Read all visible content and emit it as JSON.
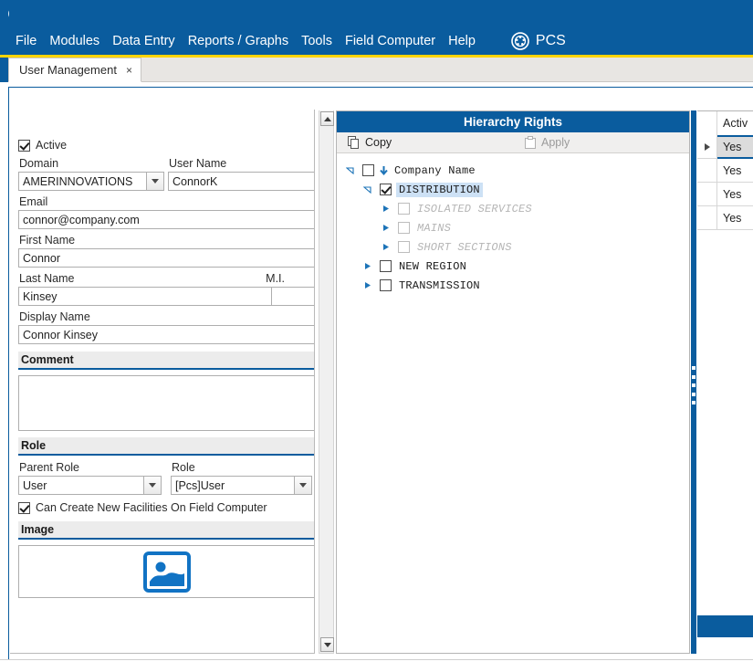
{
  "window": {
    "title": "PCS",
    "logo_icon": "pcs-circle-logo-icon"
  },
  "menubar": {
    "items": [
      {
        "label": "File"
      },
      {
        "label": "Modules"
      },
      {
        "label": "Data Entry"
      },
      {
        "label": "Reports / Graphs"
      },
      {
        "label": "Tools"
      },
      {
        "label": "Field Computer"
      },
      {
        "label": "Help"
      }
    ],
    "brand_label": "PCS",
    "brand_icon": "pcs-circle-logo-icon"
  },
  "tabs": [
    {
      "label": "User Management",
      "close_glyph": "×",
      "active": true
    }
  ],
  "form": {
    "active_checkbox": {
      "label": "Active",
      "checked": true
    },
    "domain": {
      "label": "Domain",
      "value": "AMERINNOVATIONS"
    },
    "user_name": {
      "label": "User Name",
      "value": "ConnorK"
    },
    "email": {
      "label": "Email",
      "value": "connor@company.com"
    },
    "first_name": {
      "label": "First Name",
      "value": "Connor"
    },
    "last_name": {
      "label": "Last Name",
      "value": "Kinsey"
    },
    "middle_initial": {
      "label": "M.I.",
      "value": ""
    },
    "display_name": {
      "label": "Display Name",
      "value": "Connor Kinsey"
    },
    "comment": {
      "section_label": "Comment",
      "value": ""
    },
    "role_section": {
      "section_label": "Role",
      "parent_role": {
        "label": "Parent Role",
        "value": "User"
      },
      "role": {
        "label": "Role",
        "value": "[Pcs]User"
      },
      "can_create_checkbox": {
        "label": "Can Create New Facilities On Field Computer",
        "checked": true
      }
    },
    "image_section": {
      "section_label": "Image",
      "placeholder_icon": "image-placeholder-icon"
    }
  },
  "hierarchy": {
    "title": "Hierarchy Rights",
    "toolbar": [
      {
        "label": "Copy",
        "icon": "copy-icon",
        "disabled": false
      },
      {
        "label": "Apply",
        "icon": "clipboard-icon",
        "disabled": true
      }
    ],
    "tree": [
      {
        "label": "Company Name",
        "depth": 0,
        "expander": "expanded",
        "checked": false,
        "dimmed": false,
        "selected": false,
        "leading_icon": "down-arrow-icon"
      },
      {
        "label": "DISTRIBUTION",
        "depth": 1,
        "expander": "expanded",
        "checked": true,
        "dimmed": false,
        "selected": true,
        "leading_icon": ""
      },
      {
        "label": "ISOLATED SERVICES",
        "depth": 2,
        "expander": "collapsed",
        "checked": false,
        "dimmed": true,
        "selected": false,
        "leading_icon": ""
      },
      {
        "label": "MAINS",
        "depth": 2,
        "expander": "collapsed",
        "checked": false,
        "dimmed": true,
        "selected": false,
        "leading_icon": ""
      },
      {
        "label": "SHORT SECTIONS",
        "depth": 2,
        "expander": "collapsed",
        "checked": false,
        "dimmed": true,
        "selected": false,
        "leading_icon": ""
      },
      {
        "label": "NEW REGION",
        "depth": 1,
        "expander": "collapsed",
        "checked": false,
        "dimmed": false,
        "selected": false,
        "leading_icon": ""
      },
      {
        "label": "TRANSMISSION",
        "depth": 1,
        "expander": "collapsed",
        "checked": false,
        "dimmed": false,
        "selected": false,
        "leading_icon": ""
      }
    ]
  },
  "right_grid": {
    "column_header": "Activ",
    "rows": [
      {
        "value": "Yes",
        "selected": true
      },
      {
        "value": "Yes",
        "selected": false
      },
      {
        "value": "Yes",
        "selected": false
      },
      {
        "value": "Yes",
        "selected": false
      }
    ]
  },
  "colors": {
    "brand_blue": "#0a5c9e",
    "accent_yellow": "#ffd400",
    "selection_blue": "#cde1f5",
    "disabled_gray": "#b5b5b5"
  }
}
